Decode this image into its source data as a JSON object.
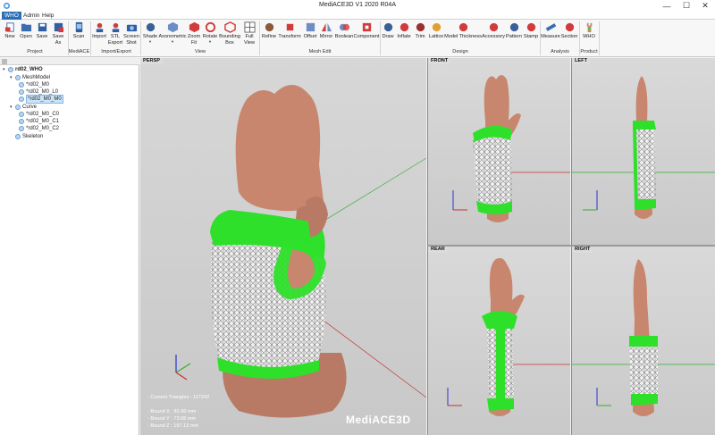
{
  "window": {
    "title": "MediACE3D V1 2020 R04A",
    "controls": {
      "minimize": "—",
      "maximize": "☐",
      "close": "✕"
    }
  },
  "menu": {
    "tabs": [
      "WHO",
      "Admin",
      "Help"
    ],
    "active": "WHO"
  },
  "ribbon": {
    "groups": {
      "project": "Project",
      "mediace": "MediACE",
      "import_export": "Import/Export",
      "view": "View",
      "mesh_edit": "Mesh Edit",
      "design": "Design",
      "analysis": "Analysis",
      "product": "Product"
    },
    "buttons": {
      "new": "New",
      "open": "Open",
      "save": "Save",
      "save_as_1": "Save",
      "save_as_2": "As",
      "scan": "Scan",
      "import": "Import",
      "stl_export_1": "STL",
      "stl_export_2": "Export",
      "screen_shot_1": "Screen",
      "screen_shot_2": "Shot",
      "shade": "Shade",
      "axonometric": "Axonometric",
      "zoom_fit_1": "Zoom",
      "zoom_fit_2": "Fit",
      "rotate": "Rotate",
      "bounding_box_1": "Bounding",
      "bounding_box_2": "Box",
      "full_view_1": "Full",
      "full_view_2": "View",
      "refine": "Refine",
      "transform": "Transform",
      "offset": "Offset",
      "mirror": "Mirror",
      "boolean": "Boolean",
      "component": "Component",
      "draw": "Draw",
      "inflate": "Inflate",
      "trim": "Trim",
      "lattice": "Lattice",
      "model_thickness": "Model Thickness",
      "accessory": "Accessory",
      "pattern": "Pattern",
      "stamp": "Stamp",
      "measure": "Measure",
      "section": "Section",
      "who": "WHO"
    }
  },
  "tree": {
    "root": "rd02_WHO",
    "meshmodel": "MeshModel",
    "mesh_items": [
      "*rd02_M0",
      "*rd02_M0_L0",
      "*rd02_M0_M0"
    ],
    "curve": "Curve",
    "curve_items": [
      "*rd02_M0_C0",
      "*rd02_M0_C1",
      "*rd02_M0_C2"
    ],
    "skeleton": "Skeleton",
    "selected": "*rd02_M0_M0"
  },
  "viewports": {
    "persp": "PERSP",
    "front": "FRONT",
    "left": "LEFT",
    "rear": "REAR",
    "right": "RIGHT"
  },
  "info": {
    "triangles": "- Current Triangles : 117242",
    "bound_x": "- Bound X : 82.60 mm",
    "bound_y": "- Bound Y : 73.06 mm",
    "bound_z": "- Bound Z : 197.13 mm"
  },
  "brand": "MediACE3D",
  "colors": {
    "accent": "#2b6fb7",
    "splint_green": "#2ee02a",
    "skin": "#c8866f",
    "lattice": "#e8e8e8"
  }
}
